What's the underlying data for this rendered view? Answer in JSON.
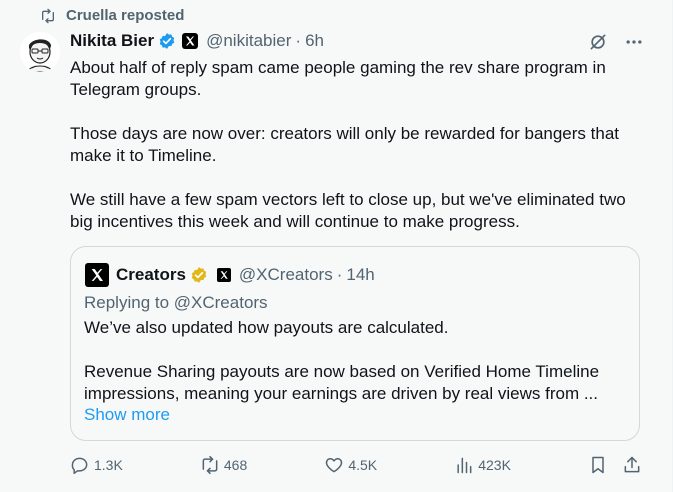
{
  "repost": {
    "label": "Cruella reposted"
  },
  "author": {
    "name": "Nikita Bier",
    "handle": "@nikitabier",
    "separator": "·",
    "time": "6h"
  },
  "post": {
    "paragraphs": [
      "About half of reply spam came people gaming the rev share program in Telegram groups.",
      "Those days are now over: creators will only be rewarded for bangers that make it to Timeline.",
      "We still have a few spam vectors left to close up, but we've eliminated two big incentives this week and will continue to make progress."
    ]
  },
  "quote": {
    "name": "Creators",
    "handle": "@XCreators",
    "separator": "·",
    "time": "14h",
    "replying_to": "Replying to @XCreators",
    "paragraphs": [
      "We’ve also updated how payouts are calculated.",
      "Revenue Sharing payouts are now based on Verified Home Timeline impressions, meaning your earnings are driven by real views from ..."
    ],
    "show_more": "Show more"
  },
  "metrics": {
    "replies": "1.3K",
    "reposts": "468",
    "likes": "4.5K",
    "views": "423K"
  },
  "colors": {
    "verified_blue": "#1d9bf0",
    "verified_gold": "#e2b719",
    "muted": "#536471",
    "link": "#1d9bf0"
  }
}
